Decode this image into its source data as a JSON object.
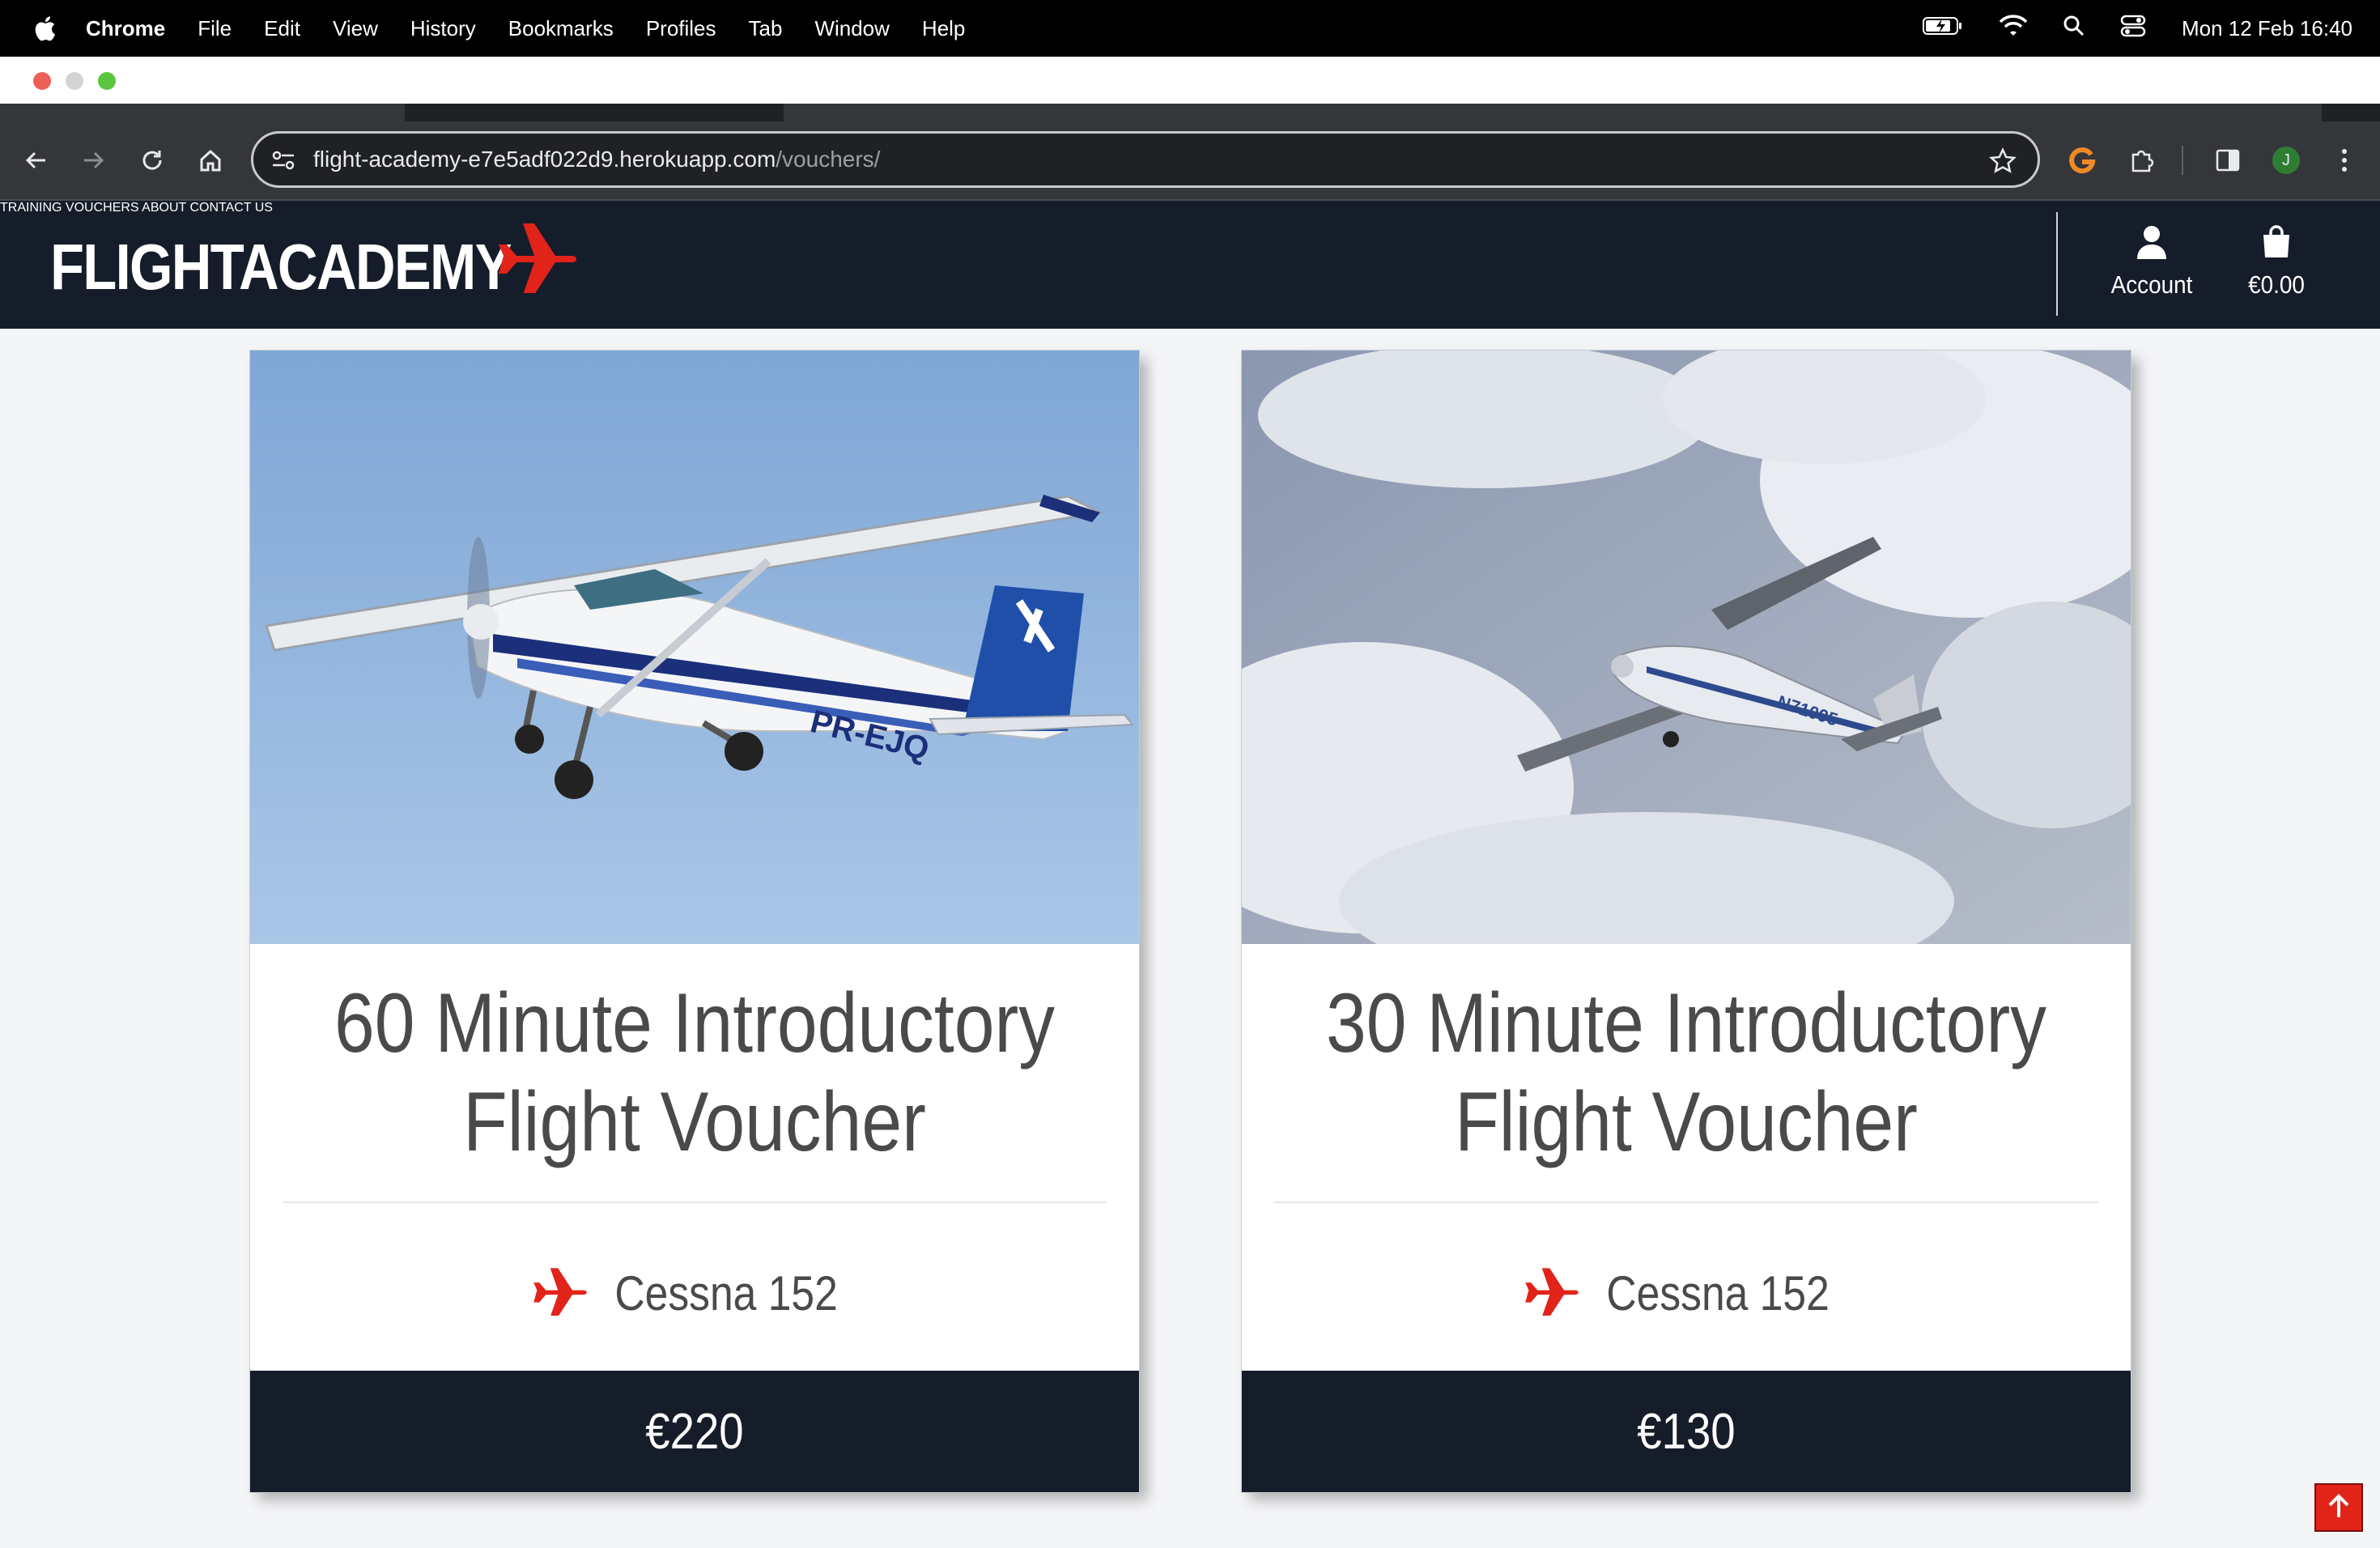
{
  "menubar": {
    "app": "Chrome",
    "items": [
      "File",
      "Edit",
      "View",
      "History",
      "Bookmarks",
      "Profiles",
      "Tab",
      "Window",
      "Help"
    ],
    "clock": "Mon 12 Feb  16:40"
  },
  "browser": {
    "url_host": "flight-academy-e7e5adf022d9.herokuapp.com",
    "url_path": "/vouchers/",
    "profile_initial": "J"
  },
  "site": {
    "logo": "FLIGHTACADEMY",
    "nav": [
      "TRAINING",
      "VOUCHERS",
      "ABOUT",
      "CONTACT US"
    ],
    "account_label": "Account",
    "cart_total": "€0.00"
  },
  "vouchers": [
    {
      "title_line1": "60 Minute Introductory",
      "title_line2": "Flight Voucher",
      "aircraft": "Cessna 152",
      "price": "€220"
    },
    {
      "title_line1": "30 Minute Introductory",
      "title_line2": "Flight Voucher",
      "aircraft": "Cessna 152",
      "price": "€130"
    }
  ],
  "colors": {
    "accent": "#e2231a",
    "header_bg": "#161d2a"
  }
}
